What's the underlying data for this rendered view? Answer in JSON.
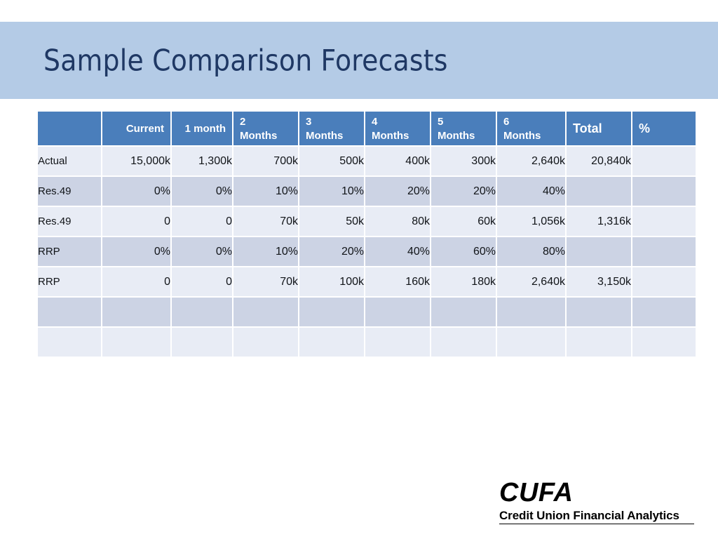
{
  "slide": {
    "title": "Sample Comparison Forecasts",
    "banner_color": "#b4cbe6",
    "title_color": "#1f3864"
  },
  "table": {
    "header_color": "#4a7ebb",
    "row_light_color": "#e8ecf5",
    "row_dark_color": "#ccd3e4",
    "headers": [
      {
        "line1": "",
        "line2": ""
      },
      {
        "line1": "Current",
        "line2": ""
      },
      {
        "line1": "1 month",
        "line2": ""
      },
      {
        "line1": "2",
        "line2": "Months"
      },
      {
        "line1": "3",
        "line2": "Months"
      },
      {
        "line1": "4",
        "line2": "Months"
      },
      {
        "line1": "5",
        "line2": "Months"
      },
      {
        "line1": "6",
        "line2": "Months"
      },
      {
        "line1": "Total",
        "line2": ""
      },
      {
        "line1": "%",
        "line2": ""
      }
    ],
    "rows": [
      {
        "label": "Actual",
        "cells": [
          "15,000k",
          "1,300k",
          "700k",
          "500k",
          "400k",
          "300k",
          "2,640k",
          "20,840k",
          ""
        ]
      },
      {
        "label": "Res.49",
        "cells": [
          "0%",
          "0%",
          "10%",
          "10%",
          "20%",
          "20%",
          "40%",
          "",
          ""
        ]
      },
      {
        "label": "Res.49",
        "cells": [
          "0",
          "0",
          "70k",
          "50k",
          "80k",
          "60k",
          "1,056k",
          "1,316k",
          ""
        ]
      },
      {
        "label": "RRP",
        "cells": [
          "0%",
          "0%",
          "10%",
          "20%",
          "40%",
          "60%",
          "80%",
          "",
          ""
        ]
      },
      {
        "label": "RRP",
        "cells": [
          "0",
          "0",
          "70k",
          "100k",
          "160k",
          "180k",
          "2,640k",
          "3,150k",
          ""
        ]
      },
      {
        "label": "",
        "cells": [
          "",
          "",
          "",
          "",
          "",
          "",
          "",
          "",
          ""
        ]
      },
      {
        "label": "",
        "cells": [
          "",
          "",
          "",
          "",
          "",
          "",
          "",
          "",
          ""
        ]
      }
    ]
  },
  "logo": {
    "wordmark": "CUFA",
    "tagline": "Credit Union Financial Analytics"
  }
}
